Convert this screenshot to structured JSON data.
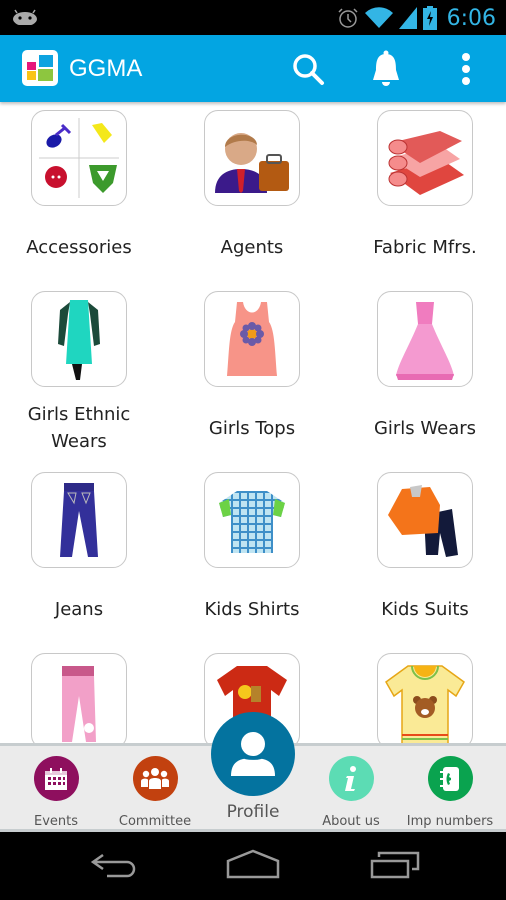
{
  "status_bar": {
    "time": "6:06",
    "icons": [
      "android-icon",
      "alarm-icon",
      "wifi-icon",
      "signal-icon",
      "battery-charging-icon"
    ]
  },
  "app_bar": {
    "title": "GGMA",
    "logo_icon": "app-logo-icon",
    "actions": [
      {
        "name": "search",
        "icon": "search-icon"
      },
      {
        "name": "notifications",
        "icon": "bell-icon"
      },
      {
        "name": "overflow-menu",
        "icon": "more-vert-icon"
      }
    ]
  },
  "categories": [
    {
      "label": "Accessories",
      "icon": "accessories-icon"
    },
    {
      "label": "Agents",
      "icon": "agent-icon"
    },
    {
      "label": "Fabric Mfrs.",
      "icon": "fabric-icon"
    },
    {
      "label": "Girls Ethnic Wears",
      "icon": "ethnic-dress-icon"
    },
    {
      "label": "Girls Tops",
      "icon": "tank-top-icon"
    },
    {
      "label": "Girls Wears",
      "icon": "gown-icon"
    },
    {
      "label": "Jeans",
      "icon": "jeans-icon"
    },
    {
      "label": "Kids Shirts",
      "icon": "shirt-icon"
    },
    {
      "label": "Kids Suits",
      "icon": "suit-icon"
    },
    {
      "label": "",
      "icon": "pink-pants-icon"
    },
    {
      "label": "",
      "icon": "red-tshirt-icon"
    },
    {
      "label": "",
      "icon": "bear-tshirt-icon"
    }
  ],
  "bottom_nav": {
    "items": [
      {
        "label": "Events",
        "icon": "calendar-icon",
        "color": "#8e0f5e"
      },
      {
        "label": "Committee",
        "icon": "group-icon",
        "color": "#c2410f"
      },
      {
        "label": "Profile",
        "icon": "person-icon",
        "color": "#04739f"
      },
      {
        "label": "About us",
        "icon": "info-icon",
        "color": "#5cdcb4"
      },
      {
        "label": "Imp numbers",
        "icon": "phonebook-icon",
        "color": "#0aa34f"
      }
    ]
  },
  "system_nav": {
    "buttons": [
      "back",
      "home",
      "recents"
    ]
  },
  "colors": {
    "app_bar": "#03a5e2",
    "status_time": "#33b5e5"
  }
}
